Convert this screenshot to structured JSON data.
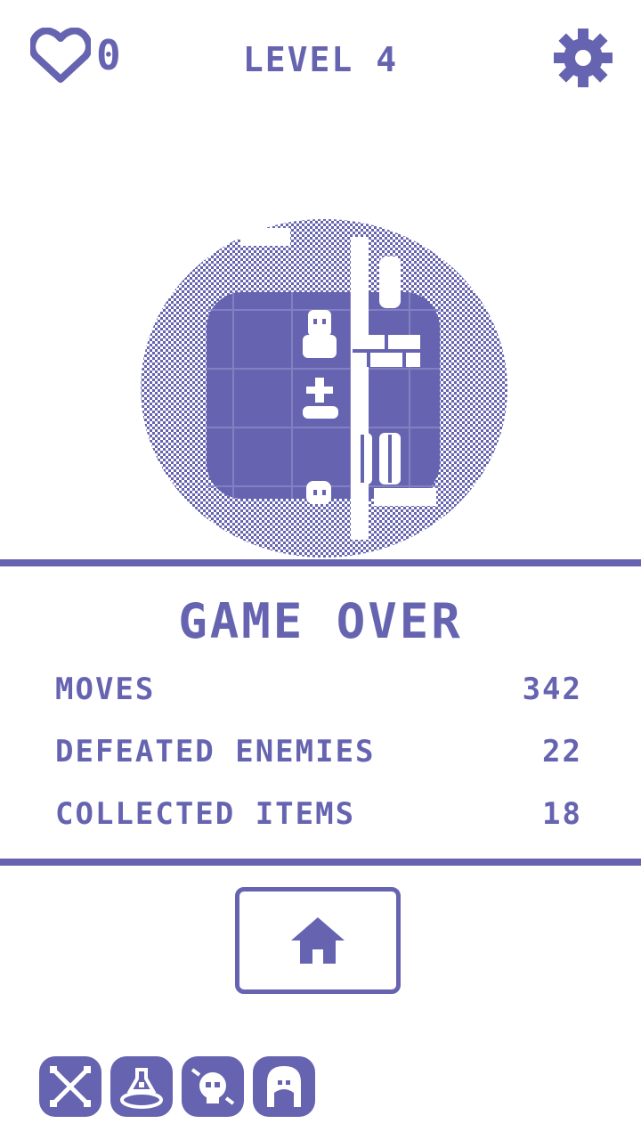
{
  "header": {
    "lives_count": "0",
    "level_label": "LEVEL 4",
    "heart_icon": "heart-icon",
    "settings_icon": "gear-icon"
  },
  "colors": {
    "accent": "#6664b0",
    "background": "#ffffff"
  },
  "result": {
    "title": "GAME OVER",
    "stats": [
      {
        "label": "MOVES",
        "value": "342"
      },
      {
        "label": "DEFEATED ENEMIES",
        "value": "22"
      },
      {
        "label": "COLLECTED ITEMS",
        "value": "18"
      }
    ]
  },
  "actions": {
    "home_icon": "home-icon"
  },
  "bottom_icons": [
    {
      "icon": "crossed-swords-icon"
    },
    {
      "icon": "potion-icon"
    },
    {
      "icon": "skull-icon"
    },
    {
      "icon": "character-icon"
    }
  ]
}
